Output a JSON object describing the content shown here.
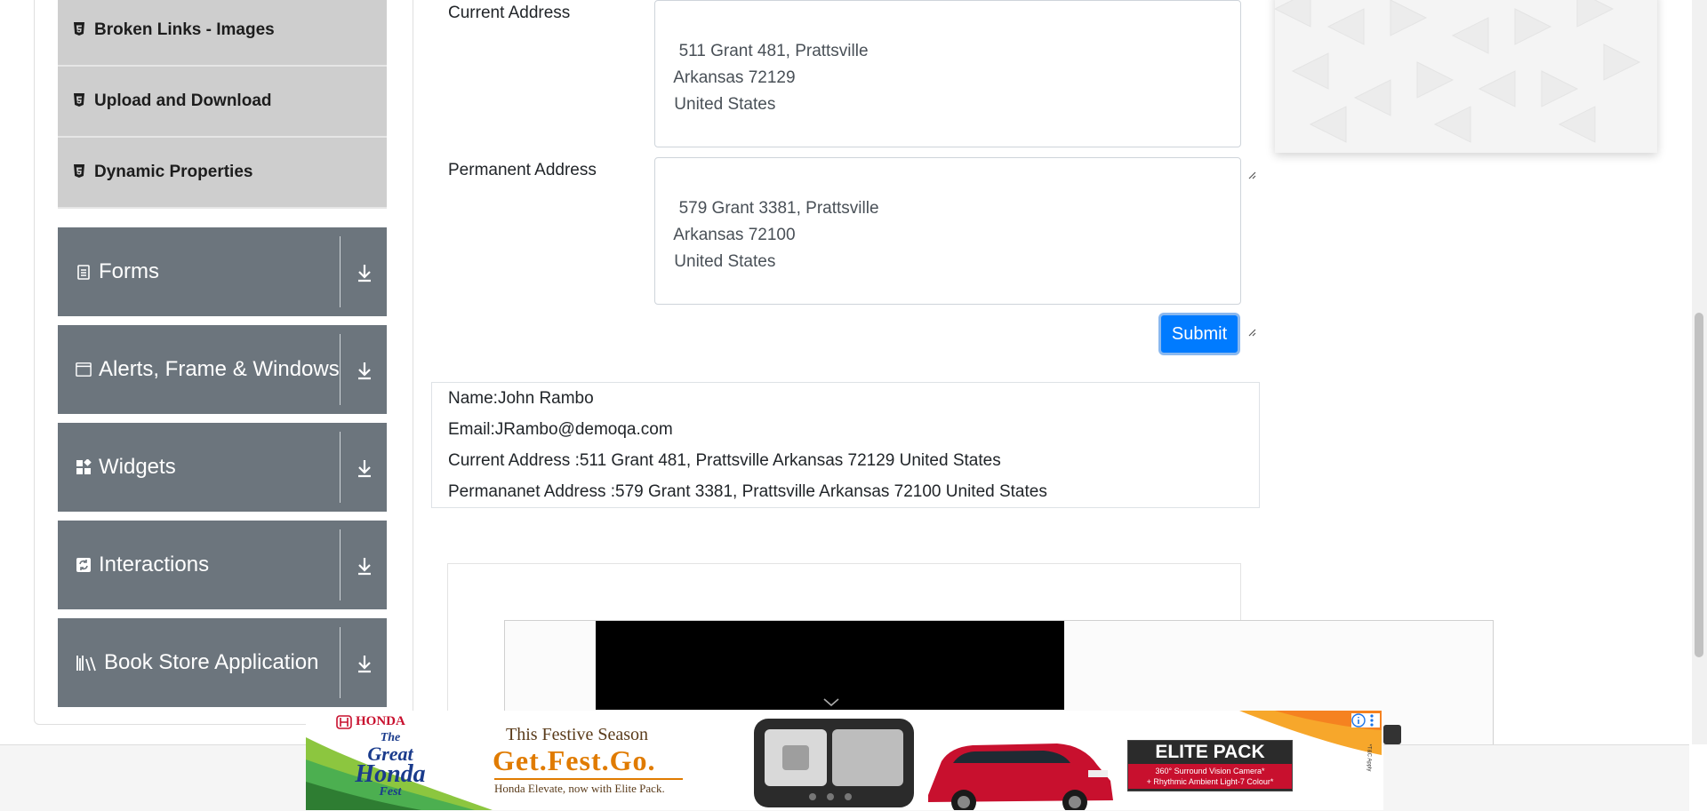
{
  "sidebar": {
    "sub_items": [
      {
        "label": "Broken Links - Images"
      },
      {
        "label": "Upload and Download"
      },
      {
        "label": "Dynamic Properties"
      }
    ],
    "groups": [
      {
        "label": "Forms",
        "icon": "document-icon"
      },
      {
        "label": "Alerts, Frame & Windows",
        "icon": "window-icon"
      },
      {
        "label": "Widgets",
        "icon": "widgets-icon"
      },
      {
        "label": "Interactions",
        "icon": "refresh-icon"
      },
      {
        "label": "Book Store Application",
        "icon": "books-icon"
      }
    ]
  },
  "form": {
    "current_address_label": "Current Address",
    "current_address_value": "511 Grant 481, Prattsville\n Arkansas 72129\n United States",
    "permanent_address_label": "Permanent Address",
    "permanent_address_value": "579 Grant 3381, Prattsville\n Arkansas 72100\n United States",
    "submit_label": "Submit"
  },
  "output": {
    "name": "Name:John Rambo",
    "email": "Email:JRambo@demoqa.com",
    "current_address": "Current Address :511 Grant 481, Prattsville Arkansas 72129 United States",
    "permanent_address": "Permananet Address :579 Grant 3381, Prattsville Arkansas 72100 United States"
  },
  "ad": {
    "brand": "HONDA",
    "fest_line1": "The",
    "fest_line2": "Great",
    "fest_line3": "Honda",
    "fest_line4": "Fest",
    "festive_line": "This Festive Season",
    "tagline": "Get.Fest.Go.",
    "subline": "Honda Elevate, now with Elite Pack.",
    "pack_title": "ELITE PACK",
    "pack_feature1": "360° Surround Vision Camera*",
    "pack_feature2": "+ Rhythmic Ambient Light-7 Colour*",
    "disclaimer": "*T&C Apply",
    "car_color": "#c8102e"
  },
  "colors": {
    "sidebar_group_bg": "#6c757d",
    "sidebar_sub_bg": "#cecece",
    "primary": "#007bff"
  }
}
